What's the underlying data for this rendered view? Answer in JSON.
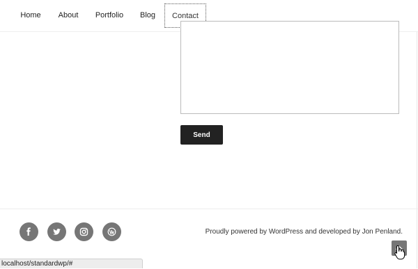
{
  "nav": {
    "items": [
      {
        "label": "Home"
      },
      {
        "label": "About"
      },
      {
        "label": "Portfolio"
      },
      {
        "label": "Blog"
      },
      {
        "label": "Contact",
        "active": true
      }
    ]
  },
  "form": {
    "message_value": "",
    "send_label": "Send"
  },
  "footer": {
    "social": [
      "facebook-icon",
      "twitter-icon",
      "instagram-icon",
      "wordpress-icon"
    ],
    "credit": "Proudly powered by WordPress and developed by Jon Penland."
  },
  "status_bar": {
    "url": "localhost/standardwp/#"
  },
  "colors": {
    "button_bg": "#222222",
    "social_bg": "#767676"
  }
}
